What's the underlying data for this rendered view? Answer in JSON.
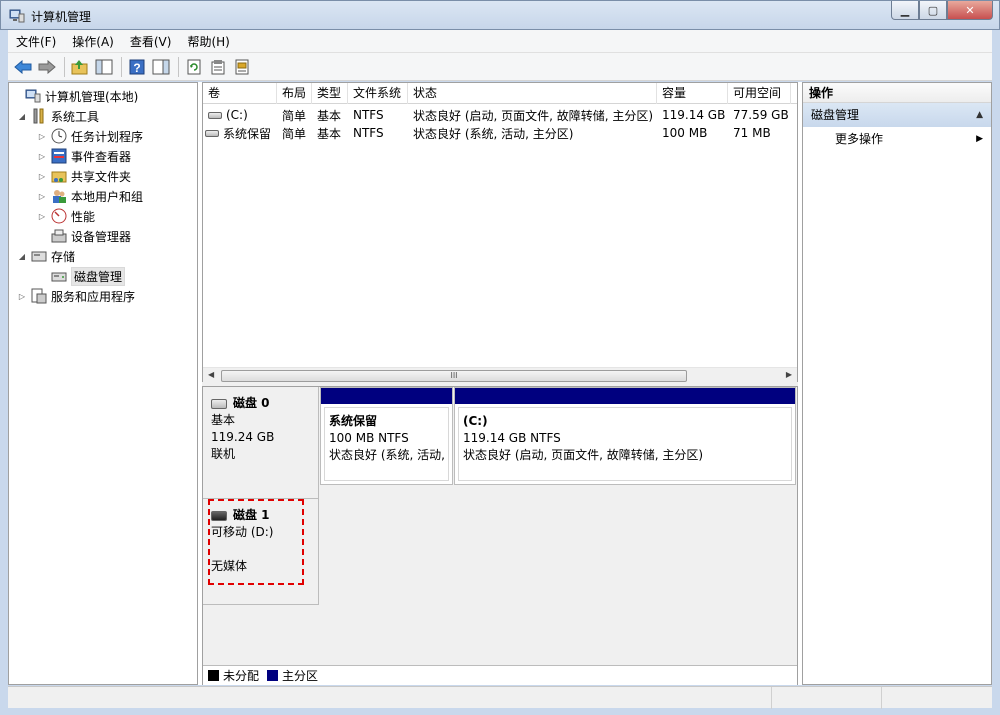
{
  "window": {
    "title": "计算机管理"
  },
  "menu": [
    {
      "label": "文件(F)"
    },
    {
      "label": "操作(A)"
    },
    {
      "label": "查看(V)"
    },
    {
      "label": "帮助(H)"
    }
  ],
  "toolbar": {
    "icons": [
      "back-arrow-icon",
      "forward-arrow-icon",
      "up-folder-icon",
      "show-hide-tree-icon",
      "help-icon",
      "action-pane-icon",
      "refresh-icon",
      "properties-icon",
      "disk-settings-icon"
    ]
  },
  "tree": {
    "root": "计算机管理(本地)",
    "system_tools": "系统工具",
    "task_scheduler": "任务计划程序",
    "event_viewer": "事件查看器",
    "shared_folders": "共享文件夹",
    "local_users": "本地用户和组",
    "performance": "性能",
    "device_manager": "设备管理器",
    "storage": "存储",
    "disk_management": "磁盘管理",
    "services_apps": "服务和应用程序"
  },
  "volume_list": {
    "columns": [
      "卷",
      "布局",
      "类型",
      "文件系统",
      "状态",
      "容量",
      "可用空间"
    ],
    "rows": [
      [
        "(C:)",
        "简单",
        "基本",
        "NTFS",
        "状态良好 (启动, 页面文件, 故障转储, 主分区)",
        "119.14 GB",
        "77.59 GB"
      ],
      [
        "系统保留",
        "简单",
        "基本",
        "NTFS",
        "状态良好 (系统, 活动, 主分区)",
        "100 MB",
        "71 MB"
      ]
    ],
    "scroll_thumb_grip": "III"
  },
  "disks": {
    "disk0": {
      "name": "磁盘 0",
      "type": "基本",
      "size": "119.24 GB",
      "status": "联机",
      "partitions": [
        {
          "name": "系统保留",
          "size": "100 MB NTFS",
          "status": "状态良好 (系统, 活动,"
        },
        {
          "name": "(C:)",
          "size": "119.14 GB NTFS",
          "status": "状态良好 (启动, 页面文件, 故障转储, 主分区)"
        }
      ]
    },
    "disk1": {
      "name": "磁盘 1",
      "type": "可移动 (D:)",
      "status": "无媒体"
    }
  },
  "legend": {
    "unallocated": "未分配",
    "primary": "主分区",
    "unallocated_color": "#000000",
    "primary_color": "#00007f"
  },
  "actions": {
    "header": "操作",
    "section": "磁盘管理",
    "more": "更多操作"
  }
}
